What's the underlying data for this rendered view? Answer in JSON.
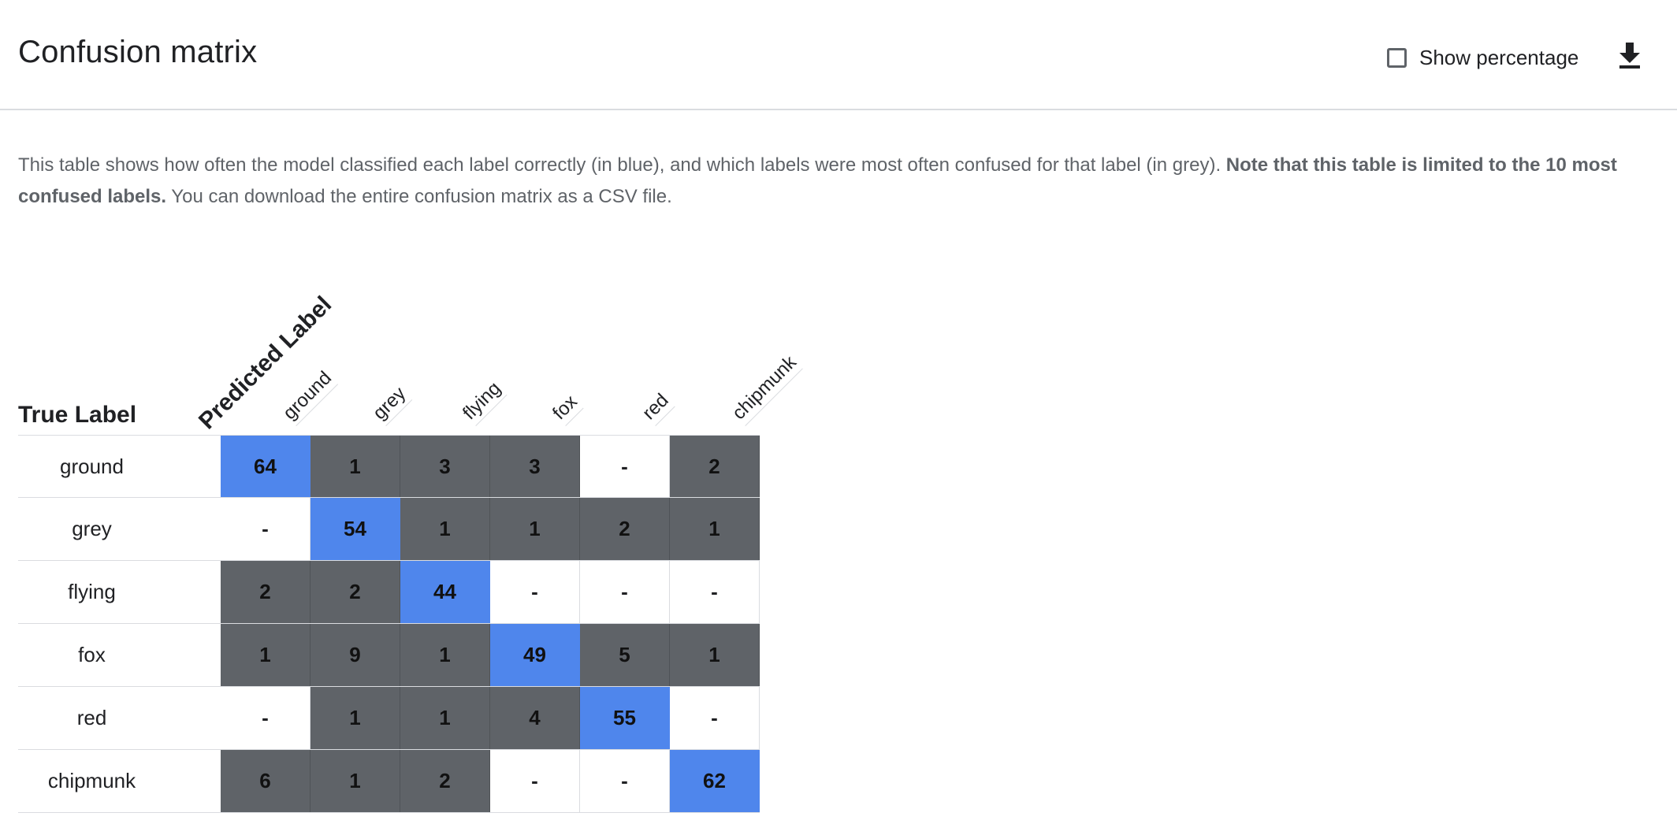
{
  "header": {
    "title": "Confusion matrix",
    "show_percentage_label": "Show percentage",
    "show_percentage_checked": false,
    "download_icon": "download-icon"
  },
  "description": {
    "text_1": "This table shows how often the model classified each label correctly (in blue), and which labels were most often confused for that label (in grey). ",
    "bold": "Note that this table is limited to the 10 most confused labels.",
    "text_2": " You can download the entire confusion matrix as a CSV file."
  },
  "matrix": {
    "true_label_heading": "True Label",
    "predicted_label_heading": "Predicted Label",
    "labels": [
      "ground",
      "grey",
      "flying",
      "fox",
      "red",
      "chipmunk"
    ],
    "rows": [
      {
        "label": "ground",
        "values": [
          "64",
          "1",
          "3",
          "3",
          "-",
          "2"
        ]
      },
      {
        "label": "grey",
        "values": [
          "-",
          "54",
          "1",
          "1",
          "2",
          "1"
        ]
      },
      {
        "label": "flying",
        "values": [
          "2",
          "2",
          "44",
          "-",
          "-",
          "-"
        ]
      },
      {
        "label": "fox",
        "values": [
          "1",
          "9",
          "1",
          "49",
          "5",
          "1"
        ]
      },
      {
        "label": "red",
        "values": [
          "-",
          "1",
          "1",
          "4",
          "55",
          "-"
        ]
      },
      {
        "label": "chipmunk",
        "values": [
          "6",
          "1",
          "2",
          "-",
          "-",
          "62"
        ]
      }
    ]
  },
  "colors": {
    "correct": "#4f86ec",
    "confused": "#5f6368",
    "zero": "#ffffff"
  }
}
